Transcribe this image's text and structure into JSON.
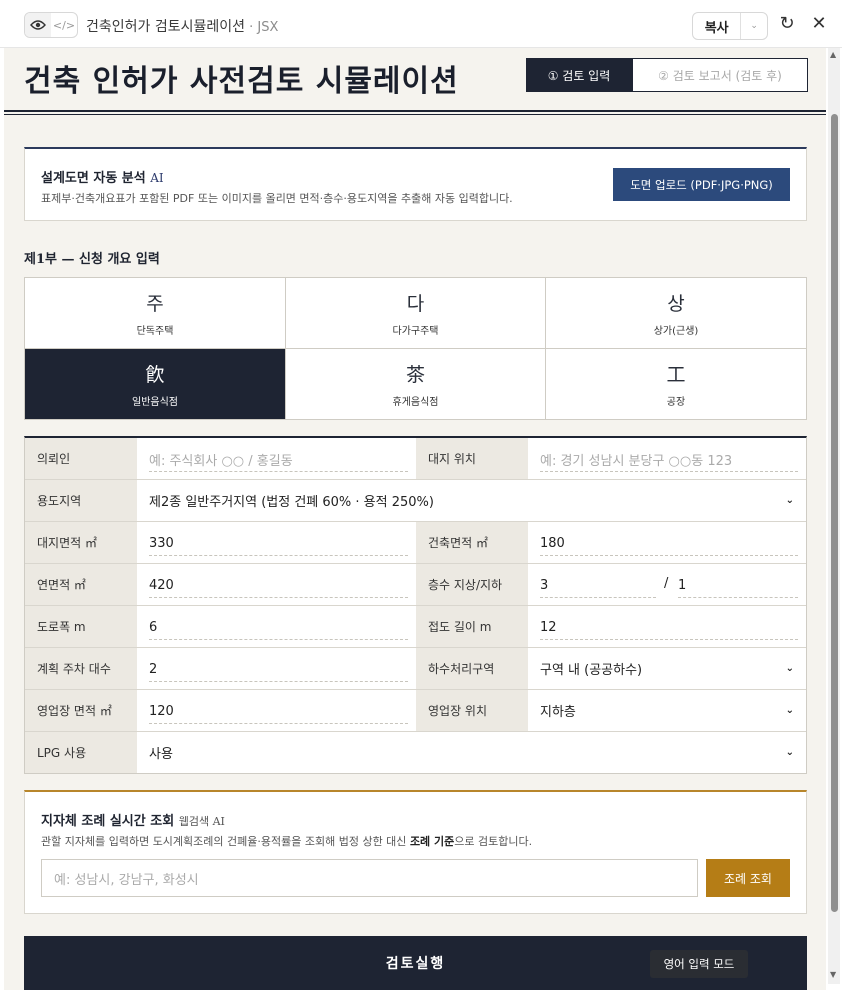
{
  "chrome": {
    "view_icon": "eye-icon",
    "code_icon": "code-icon",
    "title": "건축인허가 검토시뮬레이션",
    "subtitle": " · JSX",
    "copy_label": "복사",
    "refresh_icon": "refresh-icon",
    "close_icon": "close-icon"
  },
  "header": {
    "title": "건축 인허가 사전검토 시뮬레이션",
    "steps": [
      "① 검토 입력",
      "② 검토 보고서 (검토 후)"
    ]
  },
  "upload": {
    "title": "설계도면 자동 분석",
    "ai": "AI",
    "desc": "표제부·건축개요표가 포함된 PDF 또는 이미지를 올리면 면적·층수·용도지역을 추출해 자동 입력합니다.",
    "button": "도면 업로드 (PDF·JPG·PNG)"
  },
  "part1": {
    "title": "제1부 — 신청 개요 입력"
  },
  "types": [
    {
      "glyph": "주",
      "name": "단독주택"
    },
    {
      "glyph": "다",
      "name": "다가구주택"
    },
    {
      "glyph": "상",
      "name": "상가(근생)"
    },
    {
      "glyph": "飮",
      "name": "일반음식점"
    },
    {
      "glyph": "茶",
      "name": "휴게음식점"
    },
    {
      "glyph": "工",
      "name": "공장"
    }
  ],
  "form": {
    "applicant_label": "의뢰인",
    "applicant_placeholder": "예: 주식회사 ○○ / 홍길동",
    "site_label": "대지 위치",
    "site_placeholder": "예: 경기 성남시 분당구 ○○동 123",
    "zone_label": "용도지역",
    "zone_value": "제2종 일반주거지역 (법정 건폐 60% · 용적 250%)",
    "site_area_label": "대지면적 ㎡",
    "site_area_value": "330",
    "building_area_label": "건축면적 ㎡",
    "building_area_value": "180",
    "floor_area_label": "연면적 ㎡",
    "floor_area_value": "420",
    "floors_label": "층수 지상/지하",
    "floors_above": "3",
    "floors_sep": "/",
    "floors_below": "1",
    "road_width_label": "도로폭 m",
    "road_width_value": "6",
    "frontage_label": "접도 길이 m",
    "frontage_value": "12",
    "parking_label": "계획 주차 대수",
    "parking_value": "2",
    "sewer_label": "하수처리구역",
    "sewer_value": "구역 내 (공공하수)",
    "shop_area_label": "영업장 면적 ㎡",
    "shop_area_value": "120",
    "shop_loc_label": "영업장 위치",
    "shop_loc_value": "지하층",
    "lpg_label": "LPG 사용",
    "lpg_value": "사용"
  },
  "ordinance": {
    "title": "지자체 조례 실시간 조회",
    "ai": "웹검색 AI",
    "desc_prefix": "관할 지자체를 입력하면 도시계획조례의 건폐율·용적률을 조회해 법정 상한 대신 ",
    "desc_bold": "조례 기준",
    "desc_suffix": "으로 검토합니다.",
    "placeholder": "예: 성남시, 강남구, 화성시",
    "button": "조례 조회"
  },
  "run_button": "검토실행",
  "toast": "영어 입력 모드"
}
